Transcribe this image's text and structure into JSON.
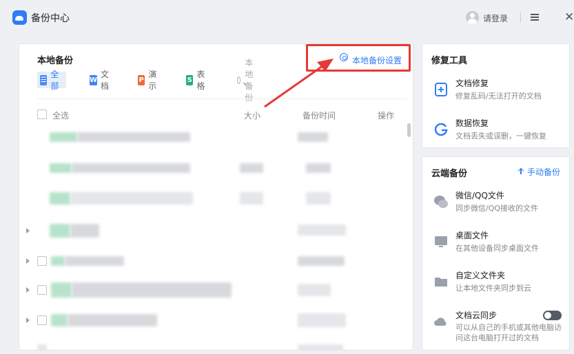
{
  "titlebar": {
    "app_title": "备份中心",
    "login_label": "请登录",
    "menu_icon": "hamburger-menu-icon",
    "close_icon": "close-icon"
  },
  "main": {
    "title": "本地备份",
    "settings_label": "本地备份设置",
    "filters": [
      {
        "label": "全部",
        "icon": "W",
        "color": "#4a8af4"
      },
      {
        "label": "文档",
        "icon": "W",
        "color": "#3f86f0"
      },
      {
        "label": "演示",
        "icon": "P",
        "color": "#ef6a37"
      },
      {
        "label": "表格",
        "icon": "S",
        "color": "#1fb07a"
      }
    ],
    "search_placeholder": "本地备份",
    "columns": {
      "select_all": "全选",
      "size": "大小",
      "time": "备份时间",
      "action": "操作"
    }
  },
  "repair": {
    "title": "修复工具",
    "items": [
      {
        "title": "文档修复",
        "desc": "修复乱码/无法打开的文档",
        "icon": "document-repair-icon"
      },
      {
        "title": "数据恢复",
        "desc": "文档丢失或误删，一键恢复",
        "icon": "data-recovery-icon"
      }
    ]
  },
  "cloud": {
    "title": "云端备份",
    "manual_label": "手动备份",
    "items": [
      {
        "title": "微信/QQ文件",
        "desc": "同步微信/QQ接收的文件",
        "icon": "chat-icon"
      },
      {
        "title": "桌面文件",
        "desc": "在其他设备同步桌面文件",
        "icon": "desktop-icon"
      },
      {
        "title": "自定义文件夹",
        "desc": "让本地文件夹同步到云",
        "icon": "folder-icon"
      },
      {
        "title": "文档云同步",
        "desc": "可以从自己的手机或其他电脑访问这台电脑打开过的文档",
        "icon": "cloud-sync-icon"
      }
    ]
  },
  "colors": {
    "accent": "#2f7cf6",
    "highlight_box": "#e53935"
  }
}
